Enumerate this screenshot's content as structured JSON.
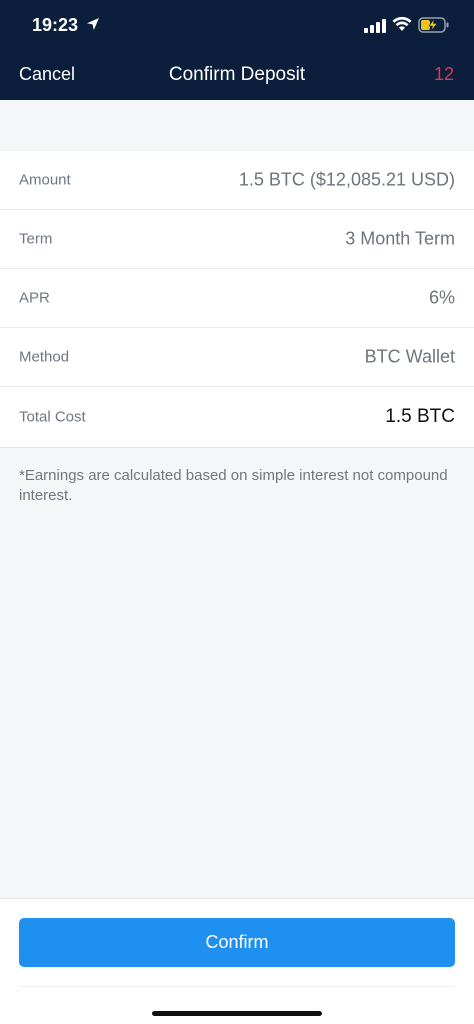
{
  "status_bar": {
    "time": "19:23",
    "icons": [
      "location-arrow-icon",
      "cellular-signal-icon",
      "wifi-icon",
      "battery-charging-icon"
    ]
  },
  "nav": {
    "cancel_label": "Cancel",
    "title": "Confirm Deposit",
    "count": "12"
  },
  "details": [
    {
      "label": "Amount",
      "value": "1.5 BTC ($12,085.21 USD)"
    },
    {
      "label": "Term",
      "value": "3 Month Term"
    },
    {
      "label": "APR",
      "value": "6%"
    },
    {
      "label": "Method",
      "value": "BTC Wallet"
    },
    {
      "label": "Total Cost",
      "value": "1.5 BTC"
    }
  ],
  "disclaimer": "*Earnings are calculated based on simple interest not compound interest.",
  "actions": {
    "confirm_label": "Confirm"
  },
  "colors": {
    "header_bg": "#0b1f3d",
    "accent_blue": "#1f90f0",
    "count_red": "#e0354f",
    "page_bg": "#f5f6f7"
  }
}
